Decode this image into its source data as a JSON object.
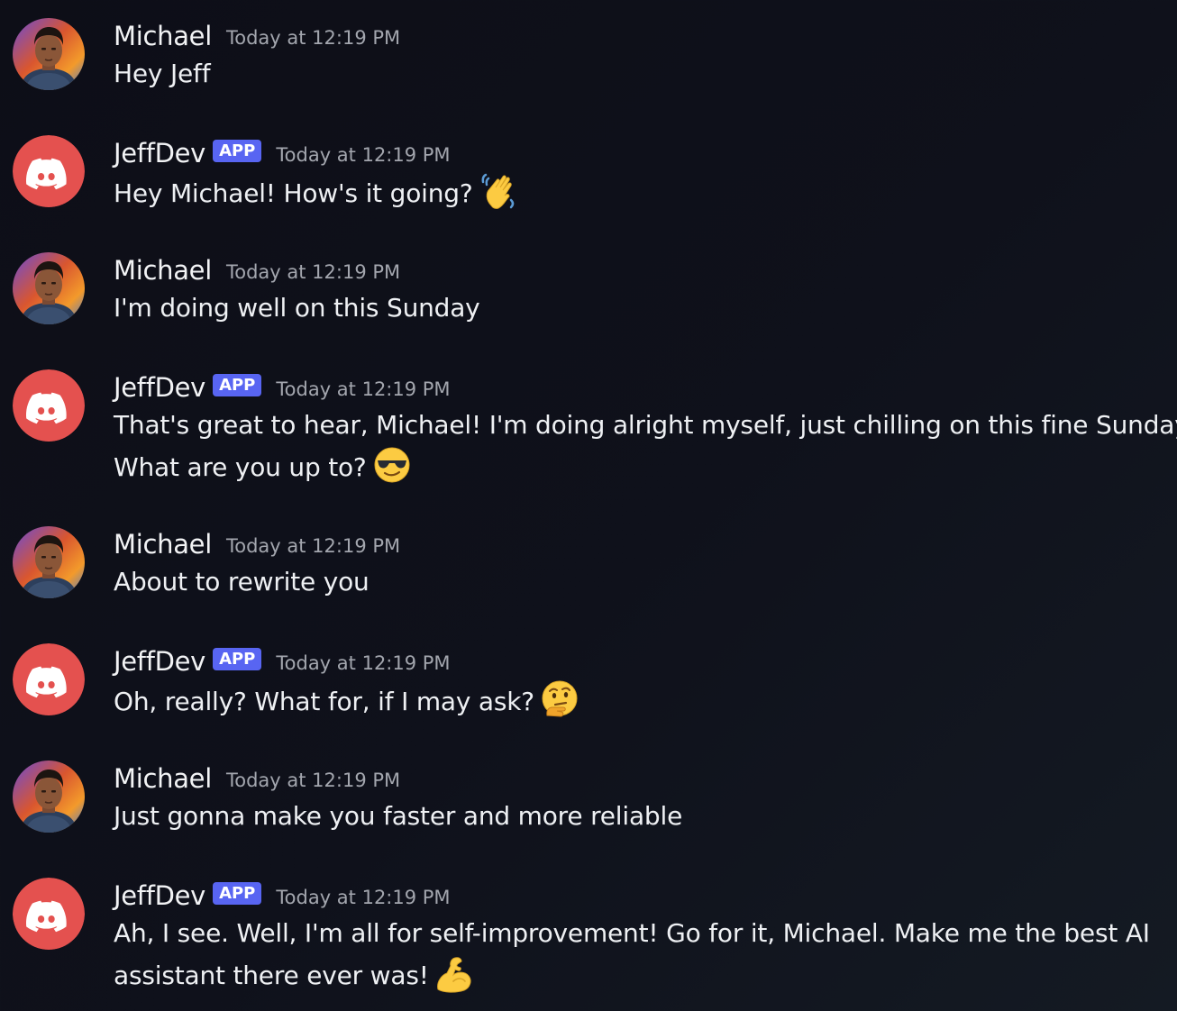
{
  "messages": [
    {
      "author": "Michael",
      "timestamp": "Today at 12:19 PM",
      "lines": [
        "Hey Jeff"
      ]
    },
    {
      "author": "JeffDev",
      "badge": "APP",
      "timestamp": "Today at 12:19 PM",
      "lines": [
        "Hey Michael! How's it going?"
      ],
      "emoji": "waving-hand-emoji"
    },
    {
      "author": "Michael",
      "timestamp": "Today at 12:19 PM",
      "lines": [
        "I'm doing well on this Sunday"
      ]
    },
    {
      "author": "JeffDev",
      "badge": "APP",
      "timestamp": "Today at 12:19 PM",
      "lines": [
        "That's great to hear, Michael! I'm doing alright myself, just chilling on this fine Sunday.",
        "What are you up to?"
      ],
      "emoji": "sunglasses-emoji"
    },
    {
      "author": "Michael",
      "timestamp": "Today at 12:19 PM",
      "lines": [
        "About to rewrite you"
      ]
    },
    {
      "author": "JeffDev",
      "badge": "APP",
      "timestamp": "Today at 12:19 PM",
      "lines": [
        "Oh, really? What for, if I may ask?"
      ],
      "emoji": "thinking-face-emoji"
    },
    {
      "author": "Michael",
      "timestamp": "Today at 12:19 PM",
      "lines": [
        "Just gonna make you faster and more reliable"
      ]
    },
    {
      "author": "JeffDev",
      "badge": "APP",
      "timestamp": "Today at 12:19 PM",
      "lines": [
        "Ah, I see. Well, I'm all for self-improvement! Go for it, Michael. Make me the best AI",
        "assistant there ever was!"
      ],
      "emoji": "flexed-biceps-emoji"
    }
  ],
  "colors": {
    "background": "#0f111b",
    "username": "#f2f3f5",
    "timestamp": "#a3a6ae",
    "app_badge": "#5865f2",
    "bot_avatar": "#e4514f"
  }
}
